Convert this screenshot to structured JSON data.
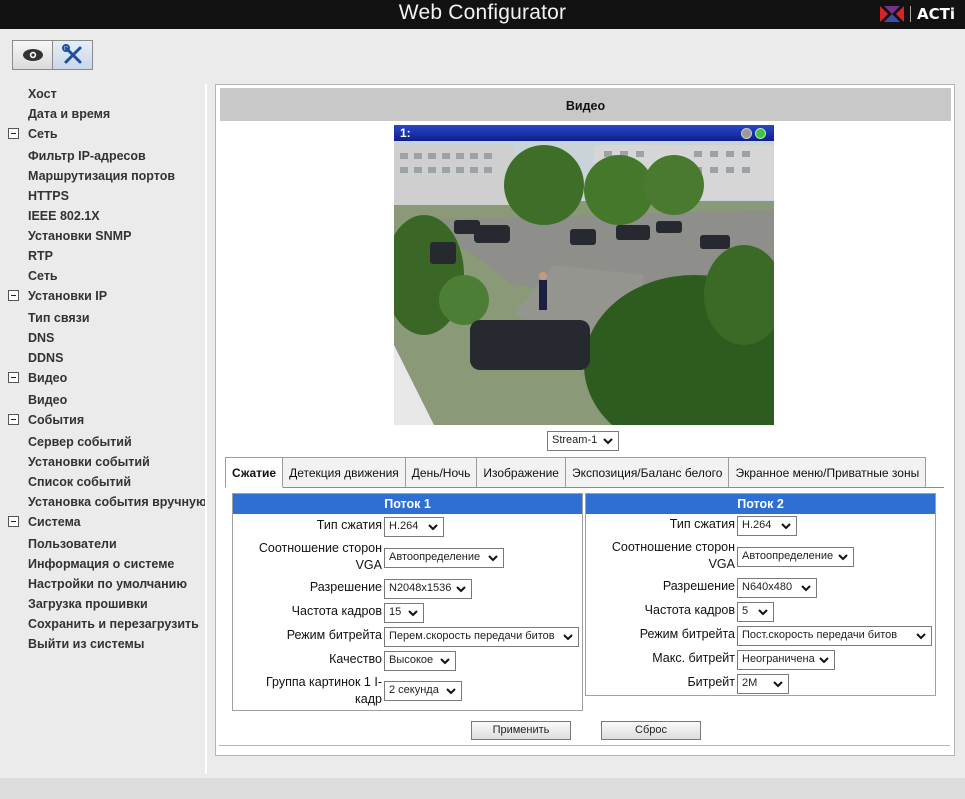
{
  "app": {
    "title": "Web Configurator",
    "logo_text": "ACTi"
  },
  "toolbar": {
    "view_icon": "eye-icon",
    "settings_icon": "wrench-screwdriver-icon"
  },
  "sidebar": {
    "items": [
      {
        "label": "Хост",
        "type": "item"
      },
      {
        "label": "Дата и время",
        "type": "item"
      },
      {
        "label": "Сеть",
        "type": "group"
      },
      {
        "label": "Фильтр IP-адресов",
        "type": "item"
      },
      {
        "label": "Маршрутизация портов",
        "type": "item"
      },
      {
        "label": "HTTPS",
        "type": "item"
      },
      {
        "label": "IEEE 802.1X",
        "type": "item"
      },
      {
        "label": "Установки SNMP",
        "type": "item"
      },
      {
        "label": "RTP",
        "type": "item"
      },
      {
        "label": "Сеть",
        "type": "item"
      },
      {
        "label": "Установки IP",
        "type": "group"
      },
      {
        "label": "Тип связи",
        "type": "item"
      },
      {
        "label": "DNS",
        "type": "item"
      },
      {
        "label": "DDNS",
        "type": "item"
      },
      {
        "label": "Видео",
        "type": "group"
      },
      {
        "label": "Видео",
        "type": "item"
      },
      {
        "label": "События",
        "type": "group"
      },
      {
        "label": "Сервер событий",
        "type": "item"
      },
      {
        "label": "Установки событий",
        "type": "item"
      },
      {
        "label": "Список событий",
        "type": "item"
      },
      {
        "label": "Установка события вручную",
        "type": "item"
      },
      {
        "label": "Система",
        "type": "group"
      },
      {
        "label": "Пользователи",
        "type": "item"
      },
      {
        "label": "Информация о системе",
        "type": "item"
      },
      {
        "label": "Настройки по умолчанию",
        "type": "item"
      },
      {
        "label": "Загрузка прошивки",
        "type": "item"
      },
      {
        "label": "Сохранить и перезагрузить",
        "type": "item"
      },
      {
        "label": "Выйти из системы",
        "type": "item"
      }
    ]
  },
  "main": {
    "page_title": "Видео",
    "video": {
      "channel_label": "1:"
    },
    "stream_select": "Stream-1",
    "tabs": [
      {
        "label": "Сжатие",
        "active": true
      },
      {
        "label": "Детекция движения",
        "active": false
      },
      {
        "label": "День/Ночь",
        "active": false
      },
      {
        "label": "Изображение",
        "active": false
      },
      {
        "label": "Экспозиция/Баланс белого",
        "active": false
      },
      {
        "label": "Экранное меню/Приватные зоны",
        "active": false
      }
    ],
    "stream1": {
      "title": "Поток 1",
      "rows": [
        {
          "label": "Тип сжатия",
          "value": "H.264"
        },
        {
          "label": "Соотношение сторон VGA",
          "value": "Автоопределение"
        },
        {
          "label": "Разрешение",
          "value": "N2048x1536"
        },
        {
          "label": "Частота кадров",
          "value": "15"
        },
        {
          "label": "Режим битрейта",
          "value": "Перем.скорость передачи битов"
        },
        {
          "label": "Качество",
          "value": "Высокое"
        },
        {
          "label": "Группа картинок 1 I-кадр",
          "value": "2 секунда"
        }
      ]
    },
    "stream2": {
      "title": "Поток 2",
      "rows": [
        {
          "label": "Тип сжатия",
          "value": "H.264"
        },
        {
          "label": "Соотношение сторон VGA",
          "value": "Автоопределение"
        },
        {
          "label": "Разрешение",
          "value": "N640x480"
        },
        {
          "label": "Частота кадров",
          "value": "5"
        },
        {
          "label": "Режим битрейта",
          "value": "Пост.скорость передачи битов"
        },
        {
          "label": "Макс. битрейт",
          "value": "Неограничена"
        },
        {
          "label": "Битрейт",
          "value": "2M"
        }
      ]
    },
    "buttons": {
      "apply": "Применить",
      "reset": "Сброс"
    }
  },
  "colors": {
    "accent": "#2e6fd1",
    "topbar": "#121212",
    "video_header": "#1a33b0"
  }
}
